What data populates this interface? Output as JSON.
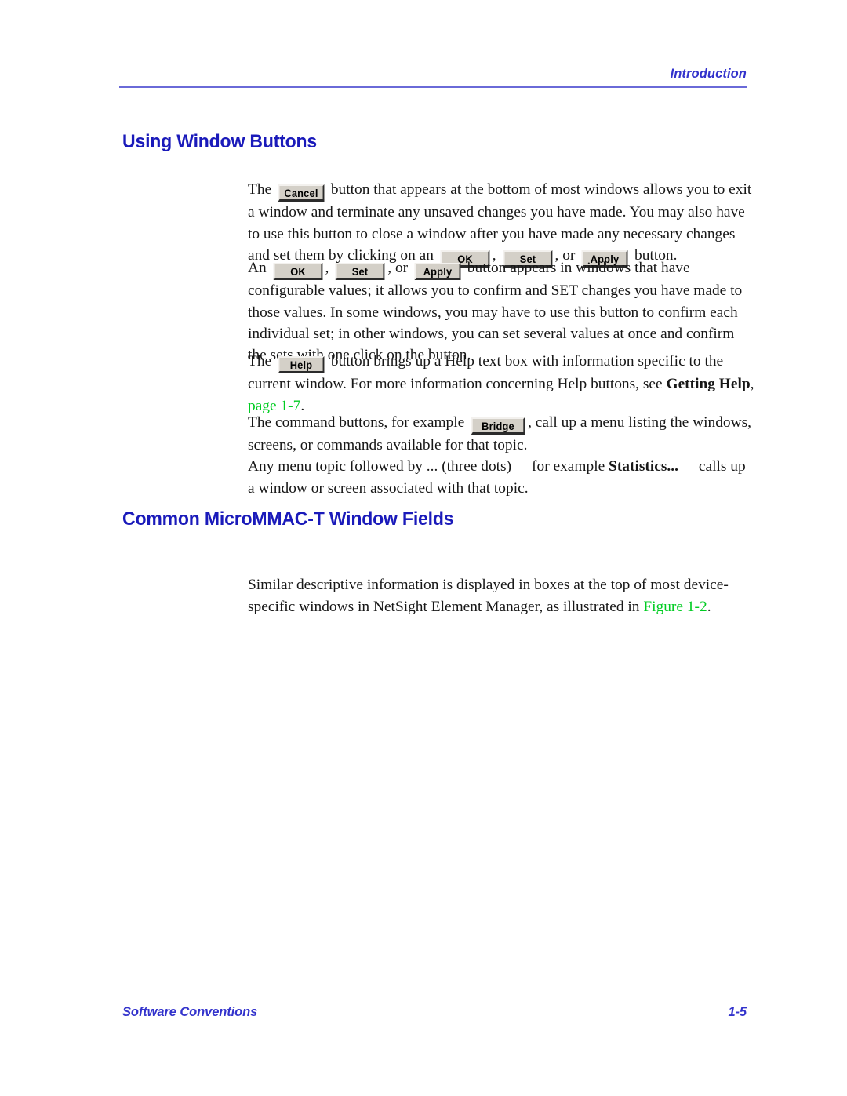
{
  "header": {
    "running_head": "Introduction"
  },
  "headings": {
    "using_window_buttons": "Using Window Buttons",
    "common_fields": "Common MicroMMAC-T Window Fields"
  },
  "buttons": {
    "cancel": "Cancel",
    "ok": "OK",
    "set": "Set",
    "apply": "Apply",
    "help": "Help",
    "bridge": "Bridge"
  },
  "paragraphs": {
    "cancel": {
      "t1": "The ",
      "t2": " button that appears at the bottom of most windows allows you to exit a window and terminate any unsaved changes you have made. You may also have to use this button to close a window after you have made any necessary changes and set them by clicking on an ",
      "t3": ", ",
      "t4": ", or ",
      "t5": " button."
    },
    "ok": {
      "t1": "An ",
      "t2": ", ",
      "t3": ", or ",
      "t4": " button appears in windows that have configurable values; it allows you to confirm and SET changes you have made to those values. In some windows, you may have to use this button to confirm each individual set; in other windows, you can set several values at once and confirm the sets with one click on the button."
    },
    "help": {
      "t1": "The ",
      "t2": " button brings up a Help text box with information specific to the current window. For more information concerning Help buttons, see ",
      "bold1": "Getting Help",
      "t3": ", ",
      "link": "page 1-7",
      "t4": "."
    },
    "command": {
      "t1": "The command buttons, for example ",
      "t2": ", call up a menu listing the windows, screens, or commands available for that topic."
    },
    "menu": {
      "t1": "Any menu topic followed by ... (three dots)",
      "t2": "for example ",
      "bold1": "Statistics...",
      "t3": "calls up a window or screen associated with that topic."
    },
    "similar": {
      "t1": "Similar descriptive information is displayed in boxes at the top of most device-specific windows in NetSight Element Manager, as illustrated in ",
      "link": "Figure 1-2",
      "t2": "."
    }
  },
  "footer": {
    "left": "Software Conventions",
    "page": "1-5"
  },
  "colors": {
    "heading_blue": "#1a1aba",
    "header_blue": "#3333cc",
    "rule_blue": "#6a6ad8",
    "link_green": "#00cc22",
    "button_face": "#d4d0c8"
  }
}
